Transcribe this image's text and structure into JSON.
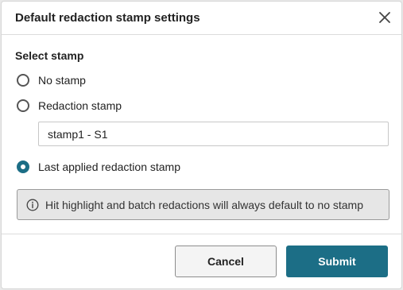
{
  "dialog": {
    "title": "Default redaction stamp settings",
    "close_icon": "close-icon"
  },
  "select_stamp": {
    "label": "Select stamp",
    "options": [
      {
        "label": "No stamp",
        "checked": false
      },
      {
        "label": "Redaction stamp",
        "checked": false
      },
      {
        "label": "Last applied redaction stamp",
        "checked": true
      }
    ],
    "stamp_value": "stamp1 - S1"
  },
  "info": {
    "icon": "info-icon",
    "text": "Hit highlight and batch redactions will always default to no stamp"
  },
  "footer": {
    "cancel_label": "Cancel",
    "submit_label": "Submit"
  },
  "colors": {
    "accent": "#1c6e86",
    "info_bg": "#e6e6e6"
  }
}
